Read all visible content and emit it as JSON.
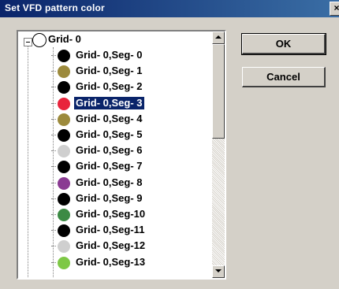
{
  "window": {
    "title": "Set VFD pattern color",
    "close_label": "×"
  },
  "tree": {
    "root": {
      "label": "Grid- 0",
      "color": "#ffffff"
    },
    "items": [
      {
        "label": "Grid- 0,Seg- 0",
        "color": "#000000"
      },
      {
        "label": "Grid- 0,Seg- 1",
        "color": "#9c8a3c"
      },
      {
        "label": "Grid- 0,Seg- 2",
        "color": "#000000"
      },
      {
        "label": "Grid- 0,Seg- 3",
        "color": "#e8243c",
        "selected": true
      },
      {
        "label": "Grid- 0,Seg- 4",
        "color": "#9c8a3c"
      },
      {
        "label": "Grid- 0,Seg- 5",
        "color": "#000000"
      },
      {
        "label": "Grid- 0,Seg- 6",
        "color": "#cfcfcf"
      },
      {
        "label": "Grid- 0,Seg- 7",
        "color": "#000000"
      },
      {
        "label": "Grid- 0,Seg- 8",
        "color": "#8a3a92"
      },
      {
        "label": "Grid- 0,Seg- 9",
        "color": "#000000"
      },
      {
        "label": "Grid- 0,Seg-10",
        "color": "#3c8a44"
      },
      {
        "label": "Grid- 0,Seg-11",
        "color": "#000000"
      },
      {
        "label": "Grid- 0,Seg-12",
        "color": "#cfcfcf"
      },
      {
        "label": "Grid- 0,Seg-13",
        "color": "#7ec846"
      }
    ]
  },
  "buttons": {
    "ok_label": "OK",
    "cancel_label": "Cancel"
  }
}
